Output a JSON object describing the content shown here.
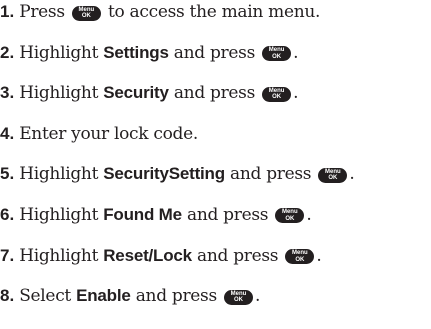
{
  "menu_key": {
    "top": "Menu",
    "bottom": "OK"
  },
  "steps": [
    {
      "num": "1.",
      "parts": [
        {
          "t": "text",
          "v": "Press "
        },
        {
          "t": "key"
        },
        {
          "t": "text",
          "v": " to access the main menu."
        }
      ]
    },
    {
      "num": "2.",
      "parts": [
        {
          "t": "text",
          "v": "Highlight "
        },
        {
          "t": "bold",
          "v": "Settings"
        },
        {
          "t": "text",
          "v": " and press "
        },
        {
          "t": "key"
        },
        {
          "t": "text",
          "v": "."
        }
      ]
    },
    {
      "num": "3.",
      "parts": [
        {
          "t": "text",
          "v": "Highlight "
        },
        {
          "t": "bold",
          "v": "Security"
        },
        {
          "t": "text",
          "v": " and press "
        },
        {
          "t": "key"
        },
        {
          "t": "text",
          "v": "."
        }
      ]
    },
    {
      "num": "4.",
      "parts": [
        {
          "t": "text",
          "v": "Enter your lock code."
        }
      ]
    },
    {
      "num": "5.",
      "parts": [
        {
          "t": "text",
          "v": "Highlight "
        },
        {
          "t": "bold",
          "v": "SecuritySetting"
        },
        {
          "t": "text",
          "v": " and press "
        },
        {
          "t": "key"
        },
        {
          "t": "text",
          "v": "."
        }
      ]
    },
    {
      "num": "6.",
      "parts": [
        {
          "t": "text",
          "v": "Highlight "
        },
        {
          "t": "bold",
          "v": "Found Me"
        },
        {
          "t": "text",
          "v": " and press "
        },
        {
          "t": "key"
        },
        {
          "t": "text",
          "v": "."
        }
      ]
    },
    {
      "num": "7.",
      "parts": [
        {
          "t": "text",
          "v": "Highlight "
        },
        {
          "t": "bold",
          "v": "Reset/Lock"
        },
        {
          "t": "text",
          "v": " and press "
        },
        {
          "t": "key"
        },
        {
          "t": "text",
          "v": "."
        }
      ]
    },
    {
      "num": "8.",
      "parts": [
        {
          "t": "text",
          "v": "Select "
        },
        {
          "t": "bold",
          "v": "Enable"
        },
        {
          "t": "text",
          "v": " and press "
        },
        {
          "t": "key"
        },
        {
          "t": "text",
          "v": "."
        }
      ]
    }
  ]
}
